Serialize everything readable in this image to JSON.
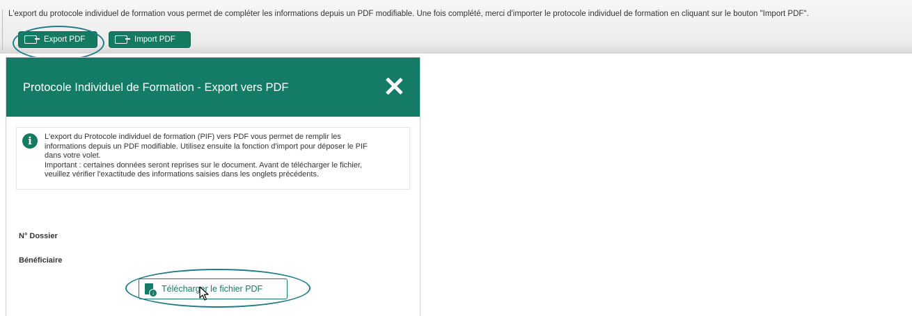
{
  "top_bar": {
    "info_text": "L'export du protocole individuel de formation vous permet de compléter les informations depuis un PDF modifiable. Une fois complété, merci d'importer le protocole individuel de formation en cliquant sur le bouton \"Import PDF\".",
    "export_button_label": "Export PDF",
    "import_button_label": "Import PDF"
  },
  "modal": {
    "title": "Protocole Individuel de Formation - Export vers PDF",
    "notice_lines": [
      "L'export du Protocole individuel de formation (PIF) vers PDF vous permet de remplir les",
      "informations depuis un PDF modifiable. Utilisez ensuite la fonction d'import pour déposer le PIF",
      "dans votre volet.",
      "Important : certaines données seront reprises sur le document. Avant de télécharger le fichier,",
      "veuillez vérifier l'exactitude des informations saisies dans les onglets précédents."
    ],
    "fields": {
      "dossier_label": "N° Dossier",
      "beneficiaire_label": "Bénéficiaire"
    },
    "download_button_label": "Télécharger le fichier PDF"
  },
  "colors": {
    "brand_green": "#147b67",
    "annotation_ellipse": "#1f7b86"
  },
  "icons": {
    "export": "export-file-icon",
    "import": "import-file-icon",
    "close": "close-icon",
    "info": "info-icon",
    "download": "pdf-download-icon",
    "cursor": "mouse-pointer-icon"
  }
}
